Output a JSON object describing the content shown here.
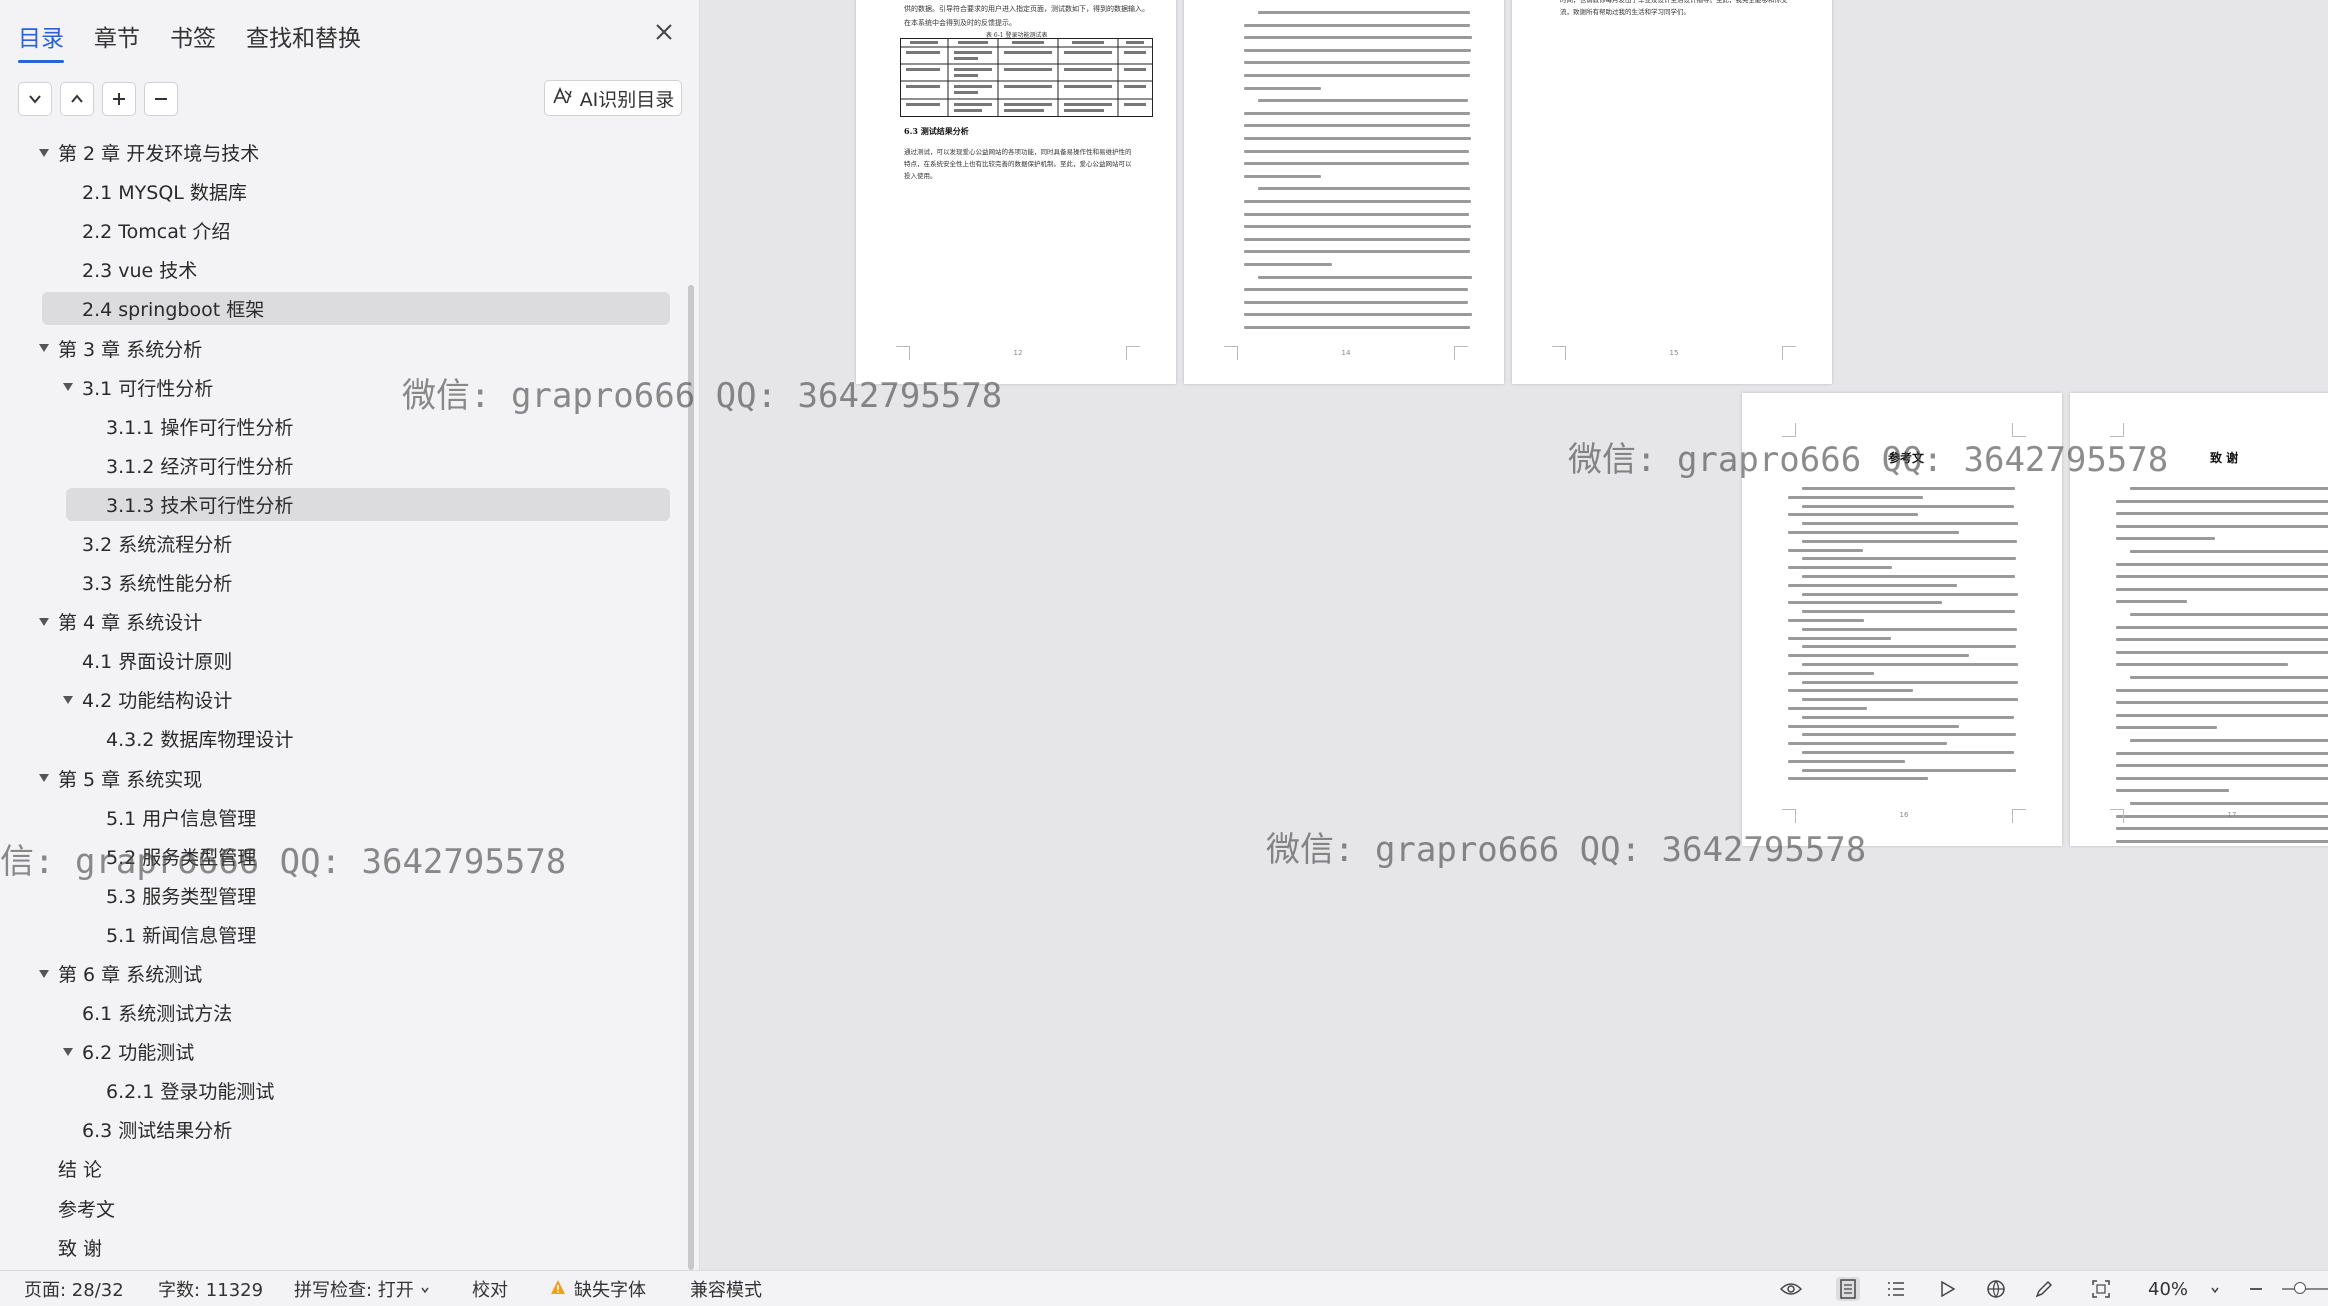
{
  "sidebar": {
    "tabs": [
      "目录",
      "章节",
      "书签",
      "查找和替换"
    ],
    "active_tab": "目录",
    "ai_button_label": "AI识别目录",
    "toc": [
      {
        "label": "第 2 章  开发环境与技术",
        "level": 0,
        "expanded": true
      },
      {
        "label": "2.1 MYSQL 数据库",
        "level": 1
      },
      {
        "label": "2.2 Tomcat  介绍",
        "level": 1
      },
      {
        "label": "2.3 vue 技术",
        "level": 1
      },
      {
        "label": "2.4 springboot 框架",
        "level": 1,
        "selected": true
      },
      {
        "label": "第 3 章  系统分析",
        "level": 0,
        "expanded": true
      },
      {
        "label": "3.1 可行性分析",
        "level": 1,
        "expanded": true
      },
      {
        "label": "3.1.1 操作可行性分析",
        "level": 2
      },
      {
        "label": "3.1.2 经济可行性分析",
        "level": 2
      },
      {
        "label": "3.1.3 技术可行性分析",
        "level": 2,
        "selected": true
      },
      {
        "label": "3.2 系统流程分析",
        "level": 1
      },
      {
        "label": "3.3 系统性能分析",
        "level": 1
      },
      {
        "label": "第 4 章  系统设计",
        "level": 0,
        "expanded": true
      },
      {
        "label": "4.1 界面设计原则",
        "level": 1
      },
      {
        "label": "4.2 功能结构设计",
        "level": 1,
        "expanded": true
      },
      {
        "label": "4.3.2  数据库物理设计",
        "level": 2
      },
      {
        "label": "第 5 章  系统实现",
        "level": 0,
        "expanded": true
      },
      {
        "label": "5.1 用户信息管理",
        "level": 2
      },
      {
        "label": "5.2 服务类型管理",
        "level": 2
      },
      {
        "label": "5.3 服务类型管理",
        "level": 2
      },
      {
        "label": "5.1 新闻信息管理",
        "level": 2
      },
      {
        "label": "第 6 章  系统测试",
        "level": 0,
        "expanded": true
      },
      {
        "label": "6.1  系统测试方法",
        "level": 1
      },
      {
        "label": "6.2  功能测试",
        "level": 1,
        "expanded": true
      },
      {
        "label": "6.2.1  登录功能测试",
        "level": 2
      },
      {
        "label": "6.3  测试结果分析",
        "level": 1
      },
      {
        "label": "结   论",
        "level": 0
      },
      {
        "label": "参考文",
        "level": 0
      },
      {
        "label": "致   谢",
        "level": 0
      }
    ]
  },
  "document": {
    "page_top_left": {
      "intro": "供的数据。引导符合要求的用户进入指定页面，测试数如下，得到的数据输入。",
      "intro2": "在本系统中会得到及时的反馈提示。",
      "table_caption": "表 6-1  登录功能测试表",
      "section_title": "6.3  测试结果分析",
      "section_body": "通过测试，可以发现爱心公益网站的各项功能，同时具备易操作性和易维护性的特点，在系统安全性上也有比较完善的数据保护机制。至此，爱心公益网站可以投入使用。",
      "page_number": "12"
    },
    "page_top_middle": {
      "page_number": "14"
    },
    "page_top_right": {
      "text": "时间，也请教你每月发出了毕业及设计生活设计指导。至此，我完全能够和你交流，致谢所有帮助过我的生活和学习同学们。",
      "page_number": "15"
    },
    "page_references": {
      "title": "参考文",
      "page_number": "16"
    },
    "page_thanks": {
      "title": "致   谢",
      "page_number": "17"
    }
  },
  "watermarks": {
    "text_full": "微信: grapro666 QQ: 3642795578",
    "text_partial": "信: grapro666 QQ: 3642795578"
  },
  "status_bar": {
    "page": "页面: 28/32",
    "word_count": "字数: 11329",
    "spell_check": "拼写检查: 打开",
    "proofread": "校对",
    "missing_font": "缺失字体",
    "compat_mode": "兼容模式",
    "zoom": "40%"
  },
  "colors": {
    "accent": "#2a62d8",
    "warning": "#f0a020"
  }
}
